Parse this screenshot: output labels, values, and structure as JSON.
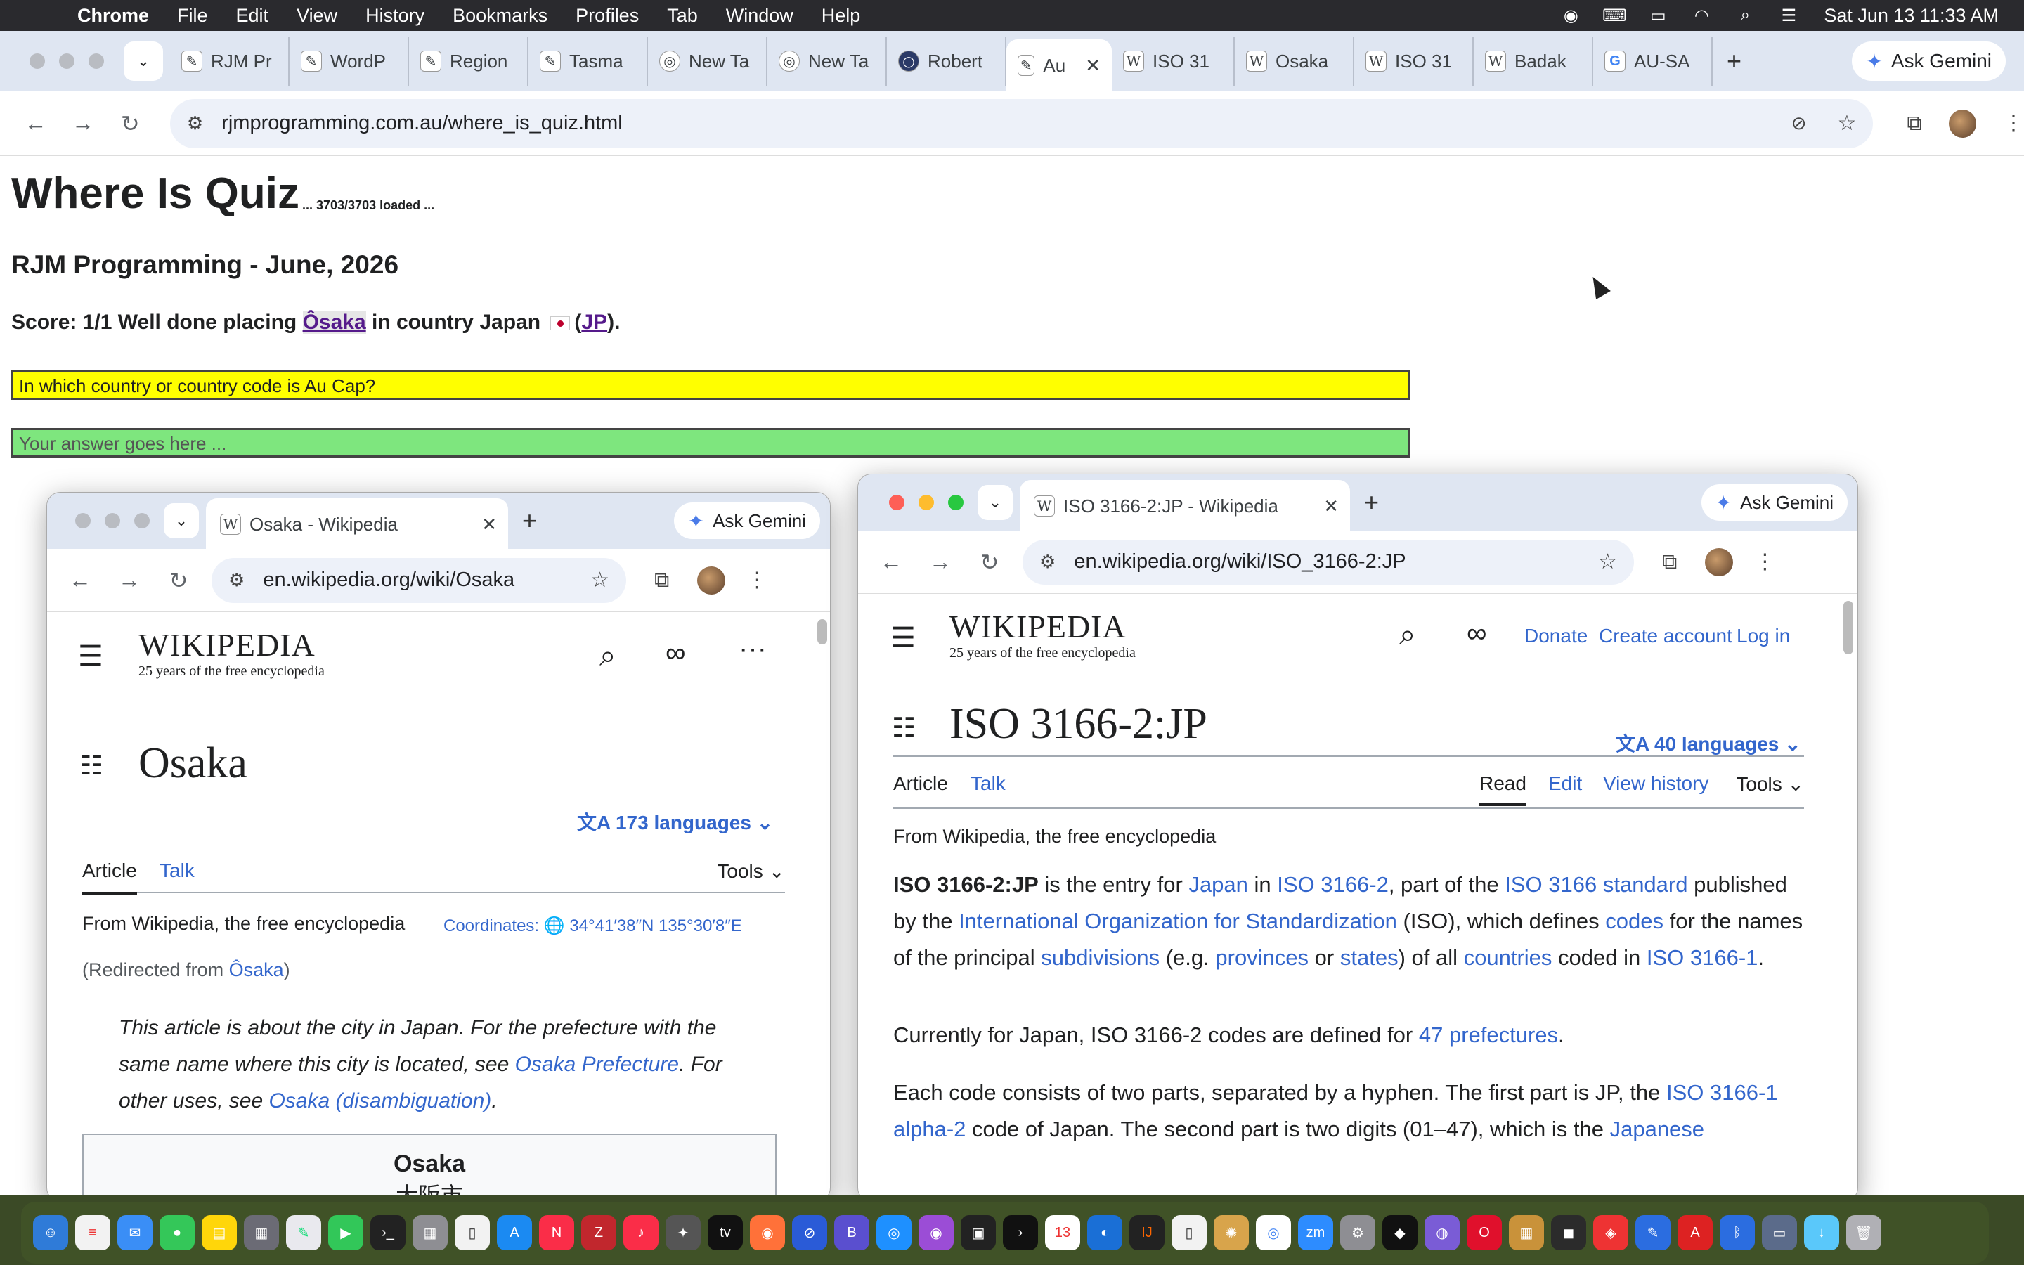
{
  "menubar": {
    "app": "Chrome",
    "items": [
      "File",
      "Edit",
      "View",
      "History",
      "Bookmarks",
      "Profiles",
      "Tab",
      "Window",
      "Help"
    ],
    "clock": "Sat Jun 13  11:33 AM"
  },
  "main": {
    "tabs": [
      {
        "label": "RJM Pr",
        "icon": "rjm-icon"
      },
      {
        "label": "WordP",
        "icon": "rjm-icon"
      },
      {
        "label": "Region",
        "icon": "rjm-icon"
      },
      {
        "label": "Tasma",
        "icon": "rjm-icon"
      },
      {
        "label": "New Ta",
        "icon": "chrome-icon"
      },
      {
        "label": "New Ta",
        "icon": "chrome-icon"
      },
      {
        "label": "Robert",
        "icon": "circle-icon"
      },
      {
        "label": "Au",
        "icon": "rjm-icon",
        "active": true
      },
      {
        "label": "ISO 31",
        "icon": "wikipedia-icon"
      },
      {
        "label": "Osaka",
        "icon": "wikipedia-icon"
      },
      {
        "label": "ISO 31",
        "icon": "wikipedia-icon"
      },
      {
        "label": "Badak",
        "icon": "wikipedia-icon"
      },
      {
        "label": "AU-SA",
        "icon": "google-icon"
      }
    ],
    "ask_gemini": "Ask Gemini",
    "url": "rjmprogramming.com.au/where_is_quiz.html"
  },
  "quiz": {
    "title": "Where Is Quiz",
    "loaded": "... 3703/3703 loaded ...",
    "subtitle": "RJM Programming - June, 2026",
    "score_prefix": "Score: 1/1 Well done placing",
    "score_place": "Ôsaka",
    "score_mid": "in country Japan",
    "score_code": "JP",
    "score_close": ").",
    "question": "In which country or country code is Au Cap?",
    "answer_placeholder": "Your answer goes here ..."
  },
  "osaka_window": {
    "tab_label": "Osaka - Wikipedia",
    "ask_gemini": "Ask Gemini",
    "url": "en.wikipedia.org/wiki/Osaka",
    "logo": "WIKIPEDIA",
    "tagline": "25 years of the free encyclopedia",
    "heading": "Osaka",
    "languages": "173 languages",
    "tab_article": "Article",
    "tab_talk": "Talk",
    "tools": "Tools",
    "from": "From Wikipedia, the free encyclopedia",
    "coordinates_label": "Coordinates",
    "coordinates_value": "34°41′38″N 135°30′8″E",
    "redirect_prefix": "(Redirected from ",
    "redirect_link": "Ôsaka",
    "redirect_suffix": ")",
    "hatnote_1": "This article is about the city in Japan. For the prefecture with the same name where this city is located, see ",
    "hatnote_link_1": "Osaka Prefecture",
    "hatnote_2": ". For other uses, see ",
    "hatnote_link_2": "Osaka (disambiguation)",
    "hatnote_3": ".",
    "infobox_title": "Osaka",
    "infobox_native": "大阪市"
  },
  "iso_window": {
    "tab_label": "ISO 3166-2:JP - Wikipedia",
    "ask_gemini": "Ask Gemini",
    "url": "en.wikipedia.org/wiki/ISO_3166-2:JP",
    "logo": "WIKIPEDIA",
    "tagline": "25 years of the free encyclopedia",
    "donate": "Donate",
    "create_account": "Create account",
    "login": "Log in",
    "heading": "ISO 3166-2:JP",
    "languages": "40 languages",
    "tab_article": "Article",
    "tab_talk": "Talk",
    "tab_read": "Read",
    "tab_edit": "Edit",
    "tab_history": "View history",
    "tools": "Tools",
    "from": "From Wikipedia, the free encyclopedia",
    "p1": {
      "b": "ISO 3166-2:JP",
      "t1": " is the entry for ",
      "l1": "Japan",
      "t2": " in ",
      "l2": "ISO 3166-2",
      "t3": ", part of the ",
      "l3": "ISO 3166 standard",
      "t4": " published by the ",
      "l4": "International Organization for Standardization",
      "t5": " (ISO), which defines ",
      "l5": "codes",
      "t6": " for the names of the principal ",
      "l6": "subdivisions",
      "t7": " (e.g. ",
      "l7": "provinces",
      "t8": " or ",
      "l8": "states",
      "t9": ") of all ",
      "l9": "countries",
      "t10": " coded in ",
      "l10": "ISO 3166-1",
      "t11": "."
    },
    "p2": {
      "t1": "Currently for Japan, ISO 3166-2 codes are defined for ",
      "l1": "47 prefectures",
      "t2": "."
    },
    "p3": {
      "t1": "Each code consists of two parts, separated by a hyphen. The first part is JP, the ",
      "l1": "ISO 3166-1 alpha-2",
      "t2": " code of Japan. The second part is two digits (01–47), which is the ",
      "l2": "Japanese"
    }
  }
}
